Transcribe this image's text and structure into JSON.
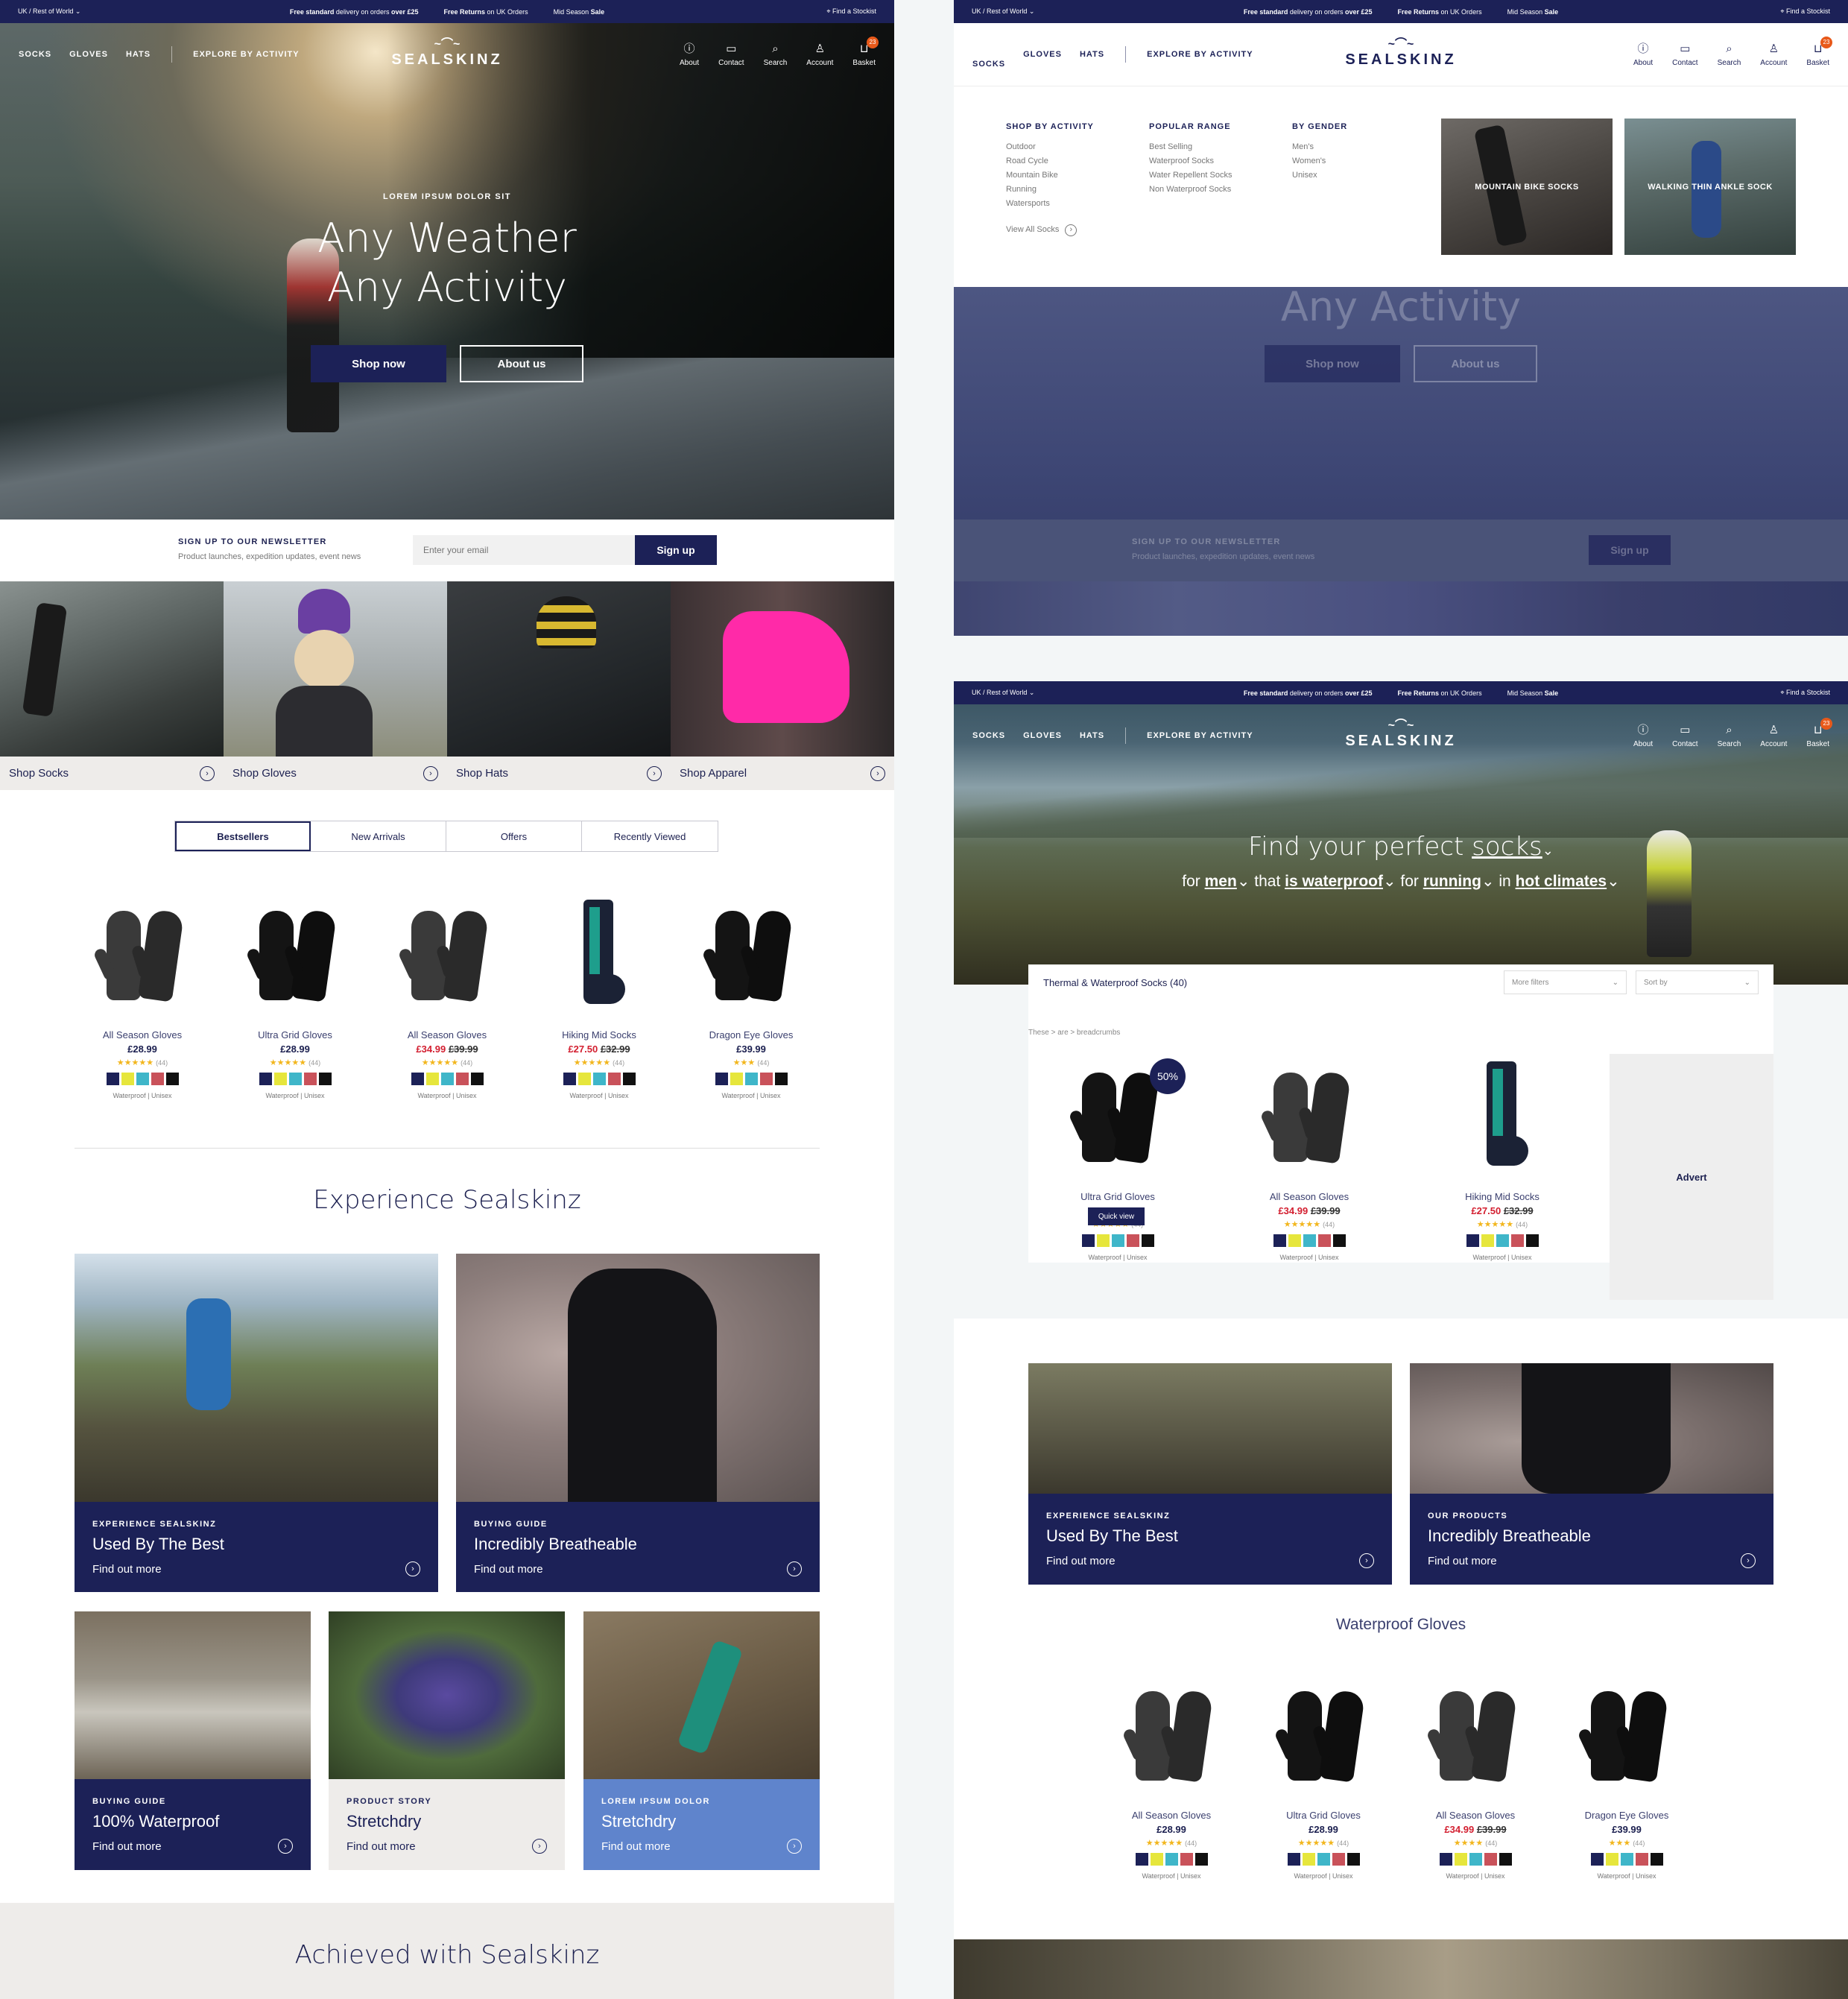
{
  "topbar": {
    "region": "UK / Rest of World",
    "delivery_bold": "Free standard",
    "delivery_text": "delivery on orders",
    "delivery_amount": "over £25",
    "returns_bold": "Free Returns",
    "returns_text": "on UK Orders",
    "sale_text": "Mid Season",
    "sale_bold": "Sale",
    "stockist": "Find a Stockist"
  },
  "nav": {
    "links": [
      "SOCKS",
      "GLOVES",
      "HATS"
    ],
    "explore": "EXPLORE BY ACTIVITY",
    "logo": "SEALSKINZ",
    "icons": [
      {
        "label": "About",
        "icon": "info-icon"
      },
      {
        "label": "Contact",
        "icon": "chat-icon"
      },
      {
        "label": "Search",
        "icon": "search-icon"
      },
      {
        "label": "Account",
        "icon": "user-icon"
      },
      {
        "label": "Basket",
        "icon": "basket-icon"
      }
    ],
    "basket_count": "23"
  },
  "hero": {
    "kicker": "LOREM IPSUM DOLOR SIT",
    "title_line1": "Any Weather",
    "title_line2": "Any Activity",
    "shop_now": "Shop now",
    "about_us": "About us"
  },
  "newsletter": {
    "title": "SIGN UP TO OUR NEWSLETTER",
    "subtitle": "Product launches, expedition updates, event news",
    "placeholder": "Enter your email",
    "button": "Sign up"
  },
  "category_tiles": [
    "Shop Socks",
    "Shop Gloves",
    "Shop Hats",
    "Shop Apparel"
  ],
  "tabs": [
    "Bestsellers",
    "New Arrivals",
    "Offers",
    "Recently Viewed"
  ],
  "swatch_colors": [
    "#1c2157",
    "#e6e63c",
    "#3fb6c9",
    "#c9525a",
    "#111111"
  ],
  "bestsellers": [
    {
      "name": "All Season Gloves",
      "price": "£28.99",
      "old": "",
      "rating": "★★★★★",
      "reviews": "(44)",
      "tags": "Waterproof | Unisex"
    },
    {
      "name": "Ultra Grid Gloves",
      "price": "£28.99",
      "old": "",
      "rating": "★★★★★",
      "reviews": "(44)",
      "tags": "Waterproof | Unisex"
    },
    {
      "name": "All Season Gloves",
      "price": "£34.99",
      "old": "£39.99",
      "rating": "★★★★★",
      "reviews": "(44)",
      "tags": "Waterproof | Unisex"
    },
    {
      "name": "Hiking Mid Socks",
      "price": "£27.50",
      "old": "£32.99",
      "rating": "★★★★★",
      "reviews": "(44)",
      "tags": "Waterproof | Unisex"
    },
    {
      "name": "Dragon Eye Gloves",
      "price": "£39.99",
      "old": "",
      "rating": "★★★",
      "reviews": "(44)",
      "tags": "Waterproof | Unisex"
    }
  ],
  "experience": {
    "heading": "Experience Sealskinz",
    "cards": [
      {
        "kicker": "EXPERIENCE SEALSKINZ",
        "title": "Used By The Best",
        "link": "Find out more"
      },
      {
        "kicker": "BUYING GUIDE",
        "title": "Incredibly Breatheable",
        "link": "Find out more"
      },
      {
        "kicker": "BUYING GUIDE",
        "title": "100% Waterproof",
        "link": "Find out more"
      },
      {
        "kicker": "PRODUCT STORY",
        "title": "Stretchdry",
        "link": "Find out more"
      },
      {
        "kicker": "LOREM IPSUM DOLOR",
        "title": "Stretchdry",
        "link": "Find out more"
      }
    ]
  },
  "achieved": "Achieved with Sealskinz",
  "megamenu": {
    "col1_title": "SHOP BY ACTIVITY",
    "col1": [
      "Outdoor",
      "Road Cycle",
      "Mountain Bike",
      "Running",
      "Watersports"
    ],
    "view_all": "View All Socks",
    "col2_title": "POPULAR RANGE",
    "col2": [
      "Best Selling",
      "Waterproof Socks",
      "Water Repellent Socks",
      "Non Waterproof Socks"
    ],
    "col3_title": "BY GENDER",
    "col3": [
      "Men's",
      "Women's",
      "Unisex"
    ],
    "promo1": "MOUNTAIN BIKE SOCKS",
    "promo2": "WALKING THIN ANKLE SOCK"
  },
  "listing": {
    "title_pre": "Find your perfect",
    "title_word": "socks",
    "for": "for",
    "gender": "men",
    "that": "that",
    "feature": "is waterproof",
    "for2": "for",
    "activity": "running",
    "in": "in",
    "climate": "hot climates",
    "result_title": "Thermal & Waterproof Socks (40)",
    "more_filters": "More filters",
    "sort_by": "Sort by",
    "breadcrumbs": "These > are > breadcrumbs",
    "discount": "50%",
    "quick_view": "Quick view",
    "advert": "Advert",
    "products": [
      {
        "name": "Ultra Grid Gloves",
        "price": "£28.99",
        "old": "",
        "rating": "★★★★★",
        "reviews": "(44)",
        "tags": "Waterproof | Unisex"
      },
      {
        "name": "All Season Gloves",
        "price": "£34.99",
        "old": "£39.99",
        "rating": "★★★★★",
        "reviews": "(44)",
        "tags": "Waterproof | Unisex"
      },
      {
        "name": "Hiking Mid Socks",
        "price": "£27.50",
        "old": "£32.99",
        "rating": "★★★★★",
        "reviews": "(44)",
        "tags": "Waterproof | Unisex"
      }
    ],
    "cards": [
      {
        "kicker": "EXPERIENCE SEALSKINZ",
        "title": "Used By The Best",
        "link": "Find out more"
      },
      {
        "kicker": "OUR PRODUCTS",
        "title": "Incredibly Breatheable",
        "link": "Find out more"
      }
    ],
    "gloves_heading": "Waterproof Gloves",
    "gloves": [
      {
        "name": "All Season Gloves",
        "price": "£28.99",
        "old": "",
        "rating": "★★★★★",
        "reviews": "(44)",
        "tags": "Waterproof | Unisex"
      },
      {
        "name": "Ultra Grid Gloves",
        "price": "£28.99",
        "old": "",
        "rating": "★★★★★",
        "reviews": "(44)",
        "tags": "Waterproof | Unisex"
      },
      {
        "name": "All Season Gloves",
        "price": "£34.99",
        "old": "£39.99",
        "rating": "★★★★",
        "reviews": "(44)",
        "tags": "Waterproof | Unisex"
      },
      {
        "name": "Dragon Eye Gloves",
        "price": "£39.99",
        "old": "",
        "rating": "★★★",
        "reviews": "(44)",
        "tags": "Waterproof | Unisex"
      }
    ]
  }
}
